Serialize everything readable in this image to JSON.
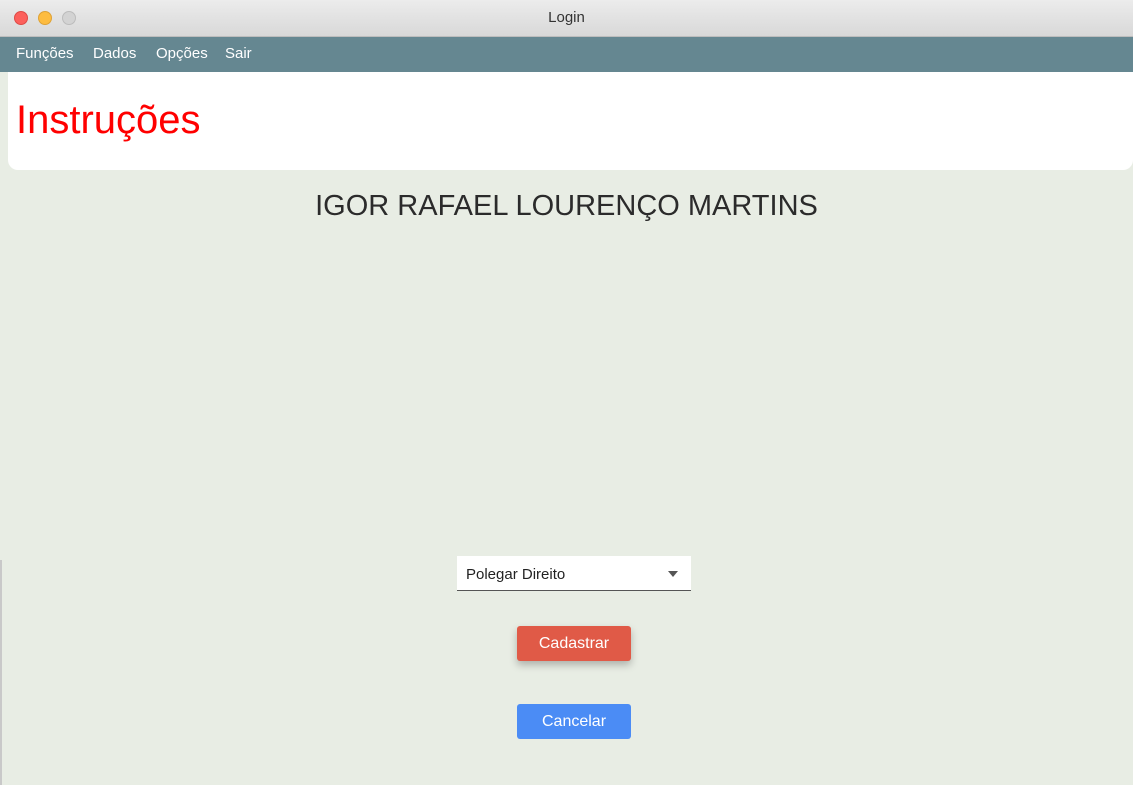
{
  "window": {
    "title": "Login"
  },
  "menu": {
    "items": [
      "Funções",
      "Dados",
      "Opções",
      "Sair"
    ]
  },
  "header": {
    "title": "Instruções"
  },
  "main": {
    "user_name": "IGOR RAFAEL LOURENÇO MARTINS",
    "finger_select": {
      "selected": "Polegar Direito"
    },
    "register_button": "Cadastrar",
    "cancel_button": "Cancelar"
  },
  "colors": {
    "menubar": "#658791",
    "title": "#ff0000",
    "register": "#e05a47",
    "cancel": "#4b8cf5",
    "background": "#e8ede4"
  }
}
